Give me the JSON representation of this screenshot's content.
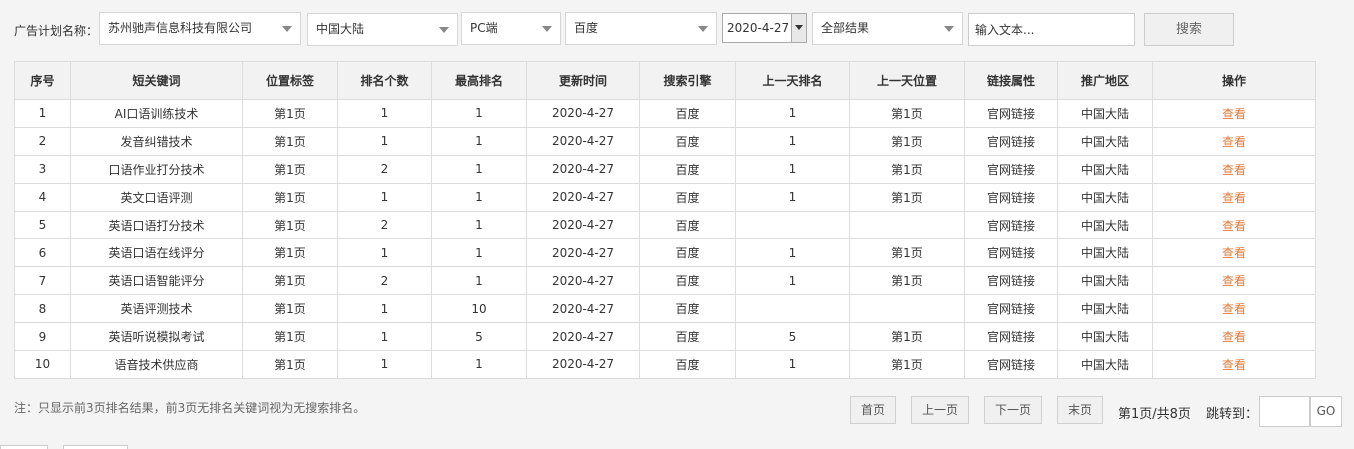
{
  "filters": {
    "label": "广告计划名称：",
    "company": "苏州驰声信息科技有限公司",
    "region": "中国大陆",
    "device": "PC端",
    "engine": "百度",
    "date": "2020-4-27",
    "result": "全部结果",
    "text_placeholder": "输入文本...",
    "search_label": "搜索"
  },
  "table": {
    "headers": [
      "序号",
      "短关键词",
      "位置标签",
      "排名个数",
      "最高排名",
      "更新时间",
      "搜索引擎",
      "上一天排名",
      "上一天位置",
      "链接属性",
      "推广地区",
      "操作"
    ],
    "rows": [
      [
        "1",
        "AI口语训练技术",
        "第1页",
        "1",
        "1",
        "2020-4-27",
        "百度",
        "1",
        "第1页",
        "官网链接",
        "中国大陆",
        "查看"
      ],
      [
        "2",
        "发音纠错技术",
        "第1页",
        "1",
        "1",
        "2020-4-27",
        "百度",
        "1",
        "第1页",
        "官网链接",
        "中国大陆",
        "查看"
      ],
      [
        "3",
        "口语作业打分技术",
        "第1页",
        "2",
        "1",
        "2020-4-27",
        "百度",
        "1",
        "第1页",
        "官网链接",
        "中国大陆",
        "查看"
      ],
      [
        "4",
        "英文口语评测",
        "第1页",
        "1",
        "1",
        "2020-4-27",
        "百度",
        "1",
        "第1页",
        "官网链接",
        "中国大陆",
        "查看"
      ],
      [
        "5",
        "英语口语打分技术",
        "第1页",
        "2",
        "1",
        "2020-4-27",
        "百度",
        "",
        "",
        "官网链接",
        "中国大陆",
        "查看"
      ],
      [
        "6",
        "英语口语在线评分",
        "第1页",
        "1",
        "1",
        "2020-4-27",
        "百度",
        "1",
        "第1页",
        "官网链接",
        "中国大陆",
        "查看"
      ],
      [
        "7",
        "英语口语智能评分",
        "第1页",
        "2",
        "1",
        "2020-4-27",
        "百度",
        "1",
        "第1页",
        "官网链接",
        "中国大陆",
        "查看"
      ],
      [
        "8",
        "英语评测技术",
        "第1页",
        "1",
        "10",
        "2020-4-27",
        "百度",
        "",
        "",
        "官网链接",
        "中国大陆",
        "查看"
      ],
      [
        "9",
        "英语听说模拟考试",
        "第1页",
        "1",
        "5",
        "2020-4-27",
        "百度",
        "5",
        "第1页",
        "官网链接",
        "中国大陆",
        "查看"
      ],
      [
        "10",
        "语音技术供应商",
        "第1页",
        "1",
        "1",
        "2020-4-27",
        "百度",
        "1",
        "第1页",
        "官网链接",
        "中国大陆",
        "查看"
      ]
    ]
  },
  "note": "注：只显示前3页排名结果，前3页无排名关键词视为无搜索排名。",
  "pagination": {
    "first": "首页",
    "prev": "上一页",
    "next": "下一页",
    "last": "末页",
    "info": "第1页/共8页",
    "jump_label": "跳转到：",
    "go": "GO"
  }
}
